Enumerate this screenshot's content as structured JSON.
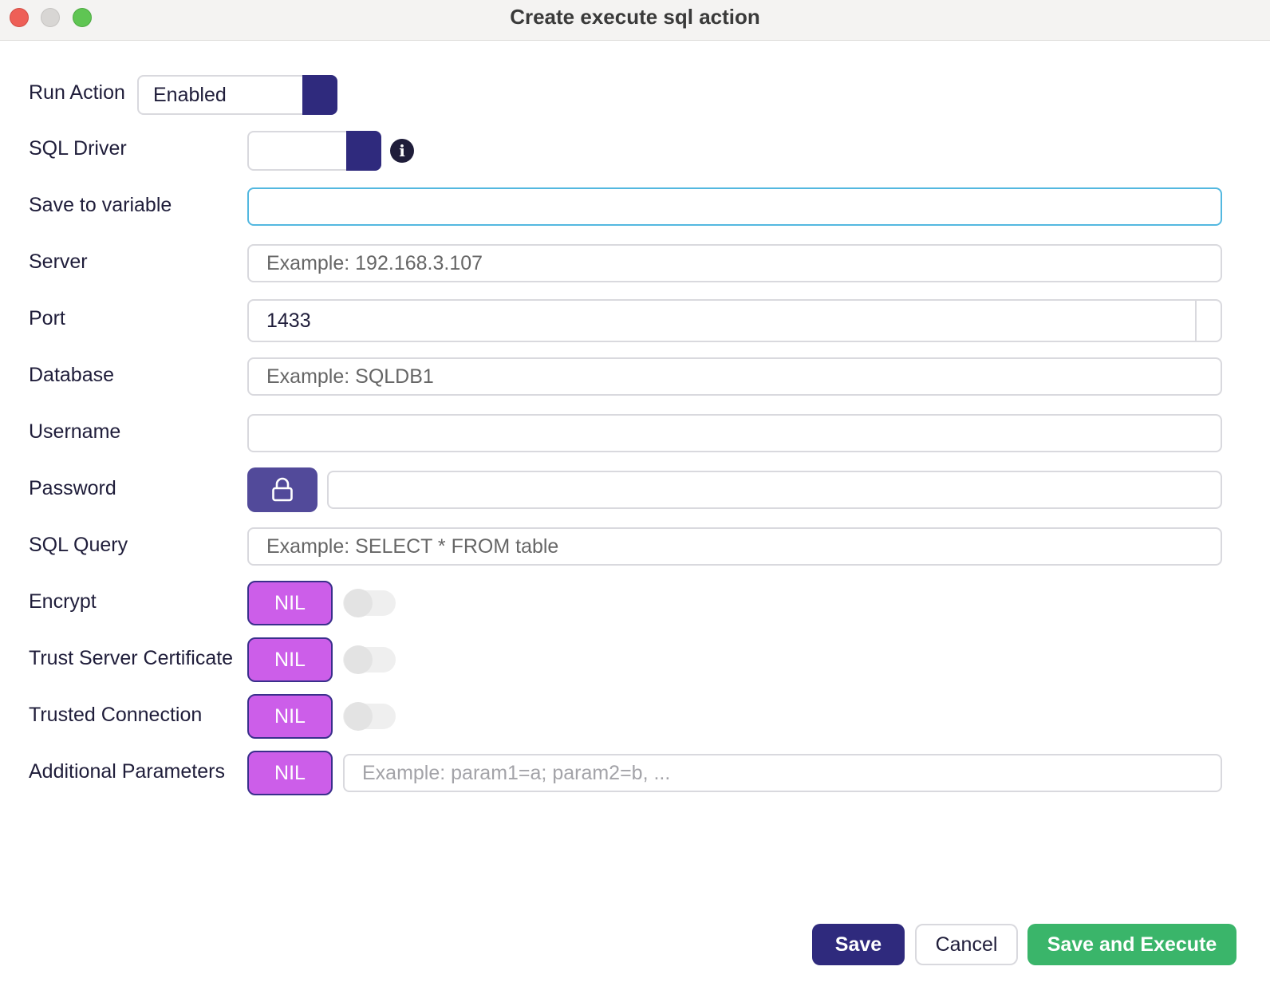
{
  "window": {
    "title": "Create execute sql action"
  },
  "form": {
    "run_action": {
      "label": "Run Action",
      "value": "Enabled"
    },
    "sql_driver": {
      "label": "SQL Driver",
      "value": ""
    },
    "save_to_variable": {
      "label": "Save to variable",
      "value": "",
      "placeholder": ""
    },
    "server": {
      "label": "Server",
      "value": "",
      "placeholder": "Example: 192.168.3.107"
    },
    "port": {
      "label": "Port",
      "value": "1433"
    },
    "database": {
      "label": "Database",
      "value": "",
      "placeholder": "Example: SQLDB1"
    },
    "username": {
      "label": "Username",
      "value": "",
      "placeholder": ""
    },
    "password": {
      "label": "Password",
      "value": "",
      "placeholder": ""
    },
    "sql_query": {
      "label": "SQL Query",
      "value": "",
      "placeholder": "Example: SELECT * FROM table"
    },
    "encrypt": {
      "label": "Encrypt",
      "nil_label": "NIL",
      "checked": false
    },
    "trust_server_certificate": {
      "label": "Trust Server Certificate",
      "nil_label": "NIL",
      "checked": false
    },
    "trusted_connection": {
      "label": "Trusted Connection",
      "nil_label": "NIL",
      "checked": false
    },
    "additional_parameters": {
      "label": "Additional Parameters",
      "nil_label": "NIL",
      "placeholder": "Example: param1=a; param2=b, ..."
    }
  },
  "footer": {
    "save_label": "Save",
    "cancel_label": "Cancel",
    "save_execute_label": "Save and Execute"
  },
  "icons": {
    "info": "info-icon",
    "lock": "lock-icon"
  },
  "colors": {
    "primary": "#2f2a7d",
    "nil_button": "#cc5ee9",
    "success": "#3ab56a",
    "focus_border": "#53b8e0"
  }
}
